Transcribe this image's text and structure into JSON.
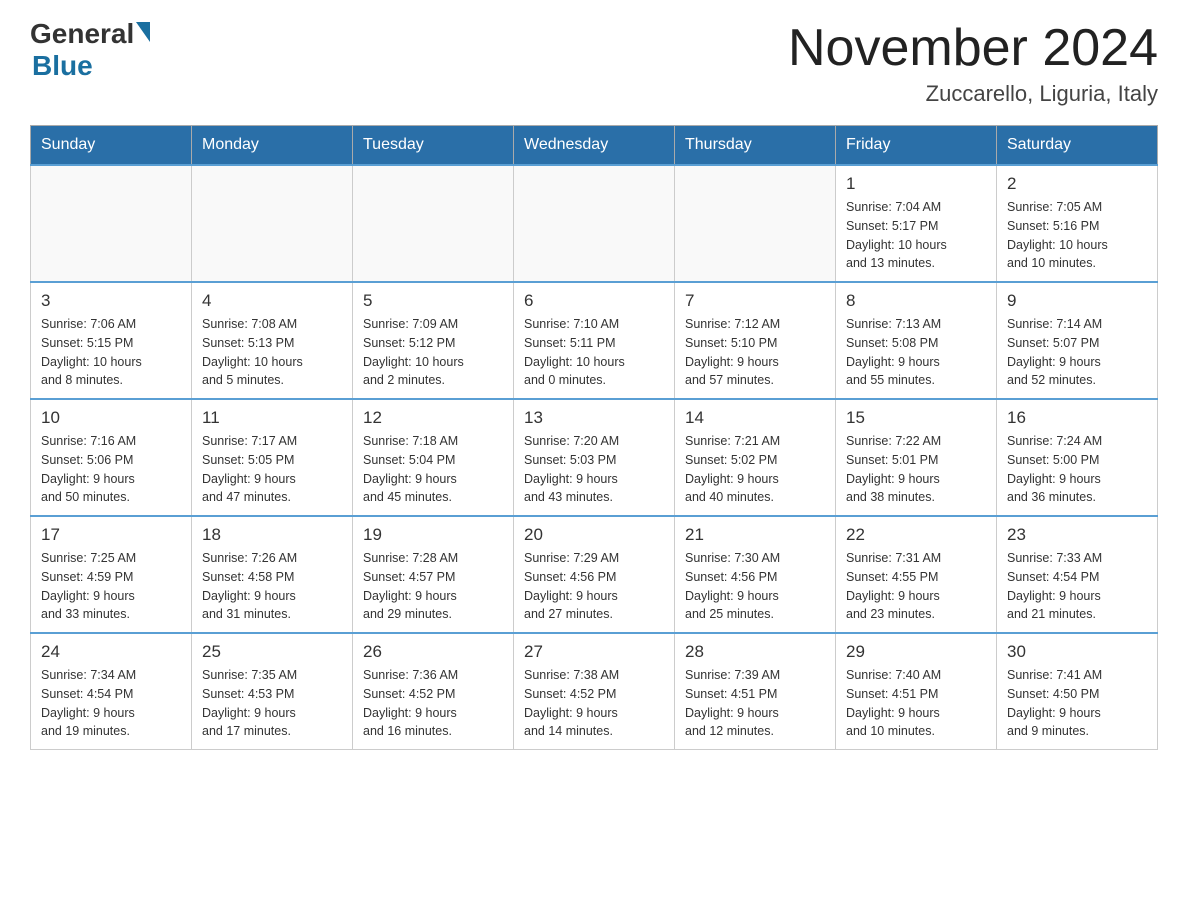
{
  "header": {
    "logo_general": "General",
    "logo_blue": "Blue",
    "title": "November 2024",
    "subtitle": "Zuccarello, Liguria, Italy"
  },
  "weekdays": [
    "Sunday",
    "Monday",
    "Tuesday",
    "Wednesday",
    "Thursday",
    "Friday",
    "Saturday"
  ],
  "weeks": [
    {
      "days": [
        {
          "num": "",
          "info": "",
          "empty": true
        },
        {
          "num": "",
          "info": "",
          "empty": true
        },
        {
          "num": "",
          "info": "",
          "empty": true
        },
        {
          "num": "",
          "info": "",
          "empty": true
        },
        {
          "num": "",
          "info": "",
          "empty": true
        },
        {
          "num": "1",
          "info": "Sunrise: 7:04 AM\nSunset: 5:17 PM\nDaylight: 10 hours\nand 13 minutes."
        },
        {
          "num": "2",
          "info": "Sunrise: 7:05 AM\nSunset: 5:16 PM\nDaylight: 10 hours\nand 10 minutes."
        }
      ]
    },
    {
      "days": [
        {
          "num": "3",
          "info": "Sunrise: 7:06 AM\nSunset: 5:15 PM\nDaylight: 10 hours\nand 8 minutes."
        },
        {
          "num": "4",
          "info": "Sunrise: 7:08 AM\nSunset: 5:13 PM\nDaylight: 10 hours\nand 5 minutes."
        },
        {
          "num": "5",
          "info": "Sunrise: 7:09 AM\nSunset: 5:12 PM\nDaylight: 10 hours\nand 2 minutes."
        },
        {
          "num": "6",
          "info": "Sunrise: 7:10 AM\nSunset: 5:11 PM\nDaylight: 10 hours\nand 0 minutes."
        },
        {
          "num": "7",
          "info": "Sunrise: 7:12 AM\nSunset: 5:10 PM\nDaylight: 9 hours\nand 57 minutes."
        },
        {
          "num": "8",
          "info": "Sunrise: 7:13 AM\nSunset: 5:08 PM\nDaylight: 9 hours\nand 55 minutes."
        },
        {
          "num": "9",
          "info": "Sunrise: 7:14 AM\nSunset: 5:07 PM\nDaylight: 9 hours\nand 52 minutes."
        }
      ]
    },
    {
      "days": [
        {
          "num": "10",
          "info": "Sunrise: 7:16 AM\nSunset: 5:06 PM\nDaylight: 9 hours\nand 50 minutes."
        },
        {
          "num": "11",
          "info": "Sunrise: 7:17 AM\nSunset: 5:05 PM\nDaylight: 9 hours\nand 47 minutes."
        },
        {
          "num": "12",
          "info": "Sunrise: 7:18 AM\nSunset: 5:04 PM\nDaylight: 9 hours\nand 45 minutes."
        },
        {
          "num": "13",
          "info": "Sunrise: 7:20 AM\nSunset: 5:03 PM\nDaylight: 9 hours\nand 43 minutes."
        },
        {
          "num": "14",
          "info": "Sunrise: 7:21 AM\nSunset: 5:02 PM\nDaylight: 9 hours\nand 40 minutes."
        },
        {
          "num": "15",
          "info": "Sunrise: 7:22 AM\nSunset: 5:01 PM\nDaylight: 9 hours\nand 38 minutes."
        },
        {
          "num": "16",
          "info": "Sunrise: 7:24 AM\nSunset: 5:00 PM\nDaylight: 9 hours\nand 36 minutes."
        }
      ]
    },
    {
      "days": [
        {
          "num": "17",
          "info": "Sunrise: 7:25 AM\nSunset: 4:59 PM\nDaylight: 9 hours\nand 33 minutes."
        },
        {
          "num": "18",
          "info": "Sunrise: 7:26 AM\nSunset: 4:58 PM\nDaylight: 9 hours\nand 31 minutes."
        },
        {
          "num": "19",
          "info": "Sunrise: 7:28 AM\nSunset: 4:57 PM\nDaylight: 9 hours\nand 29 minutes."
        },
        {
          "num": "20",
          "info": "Sunrise: 7:29 AM\nSunset: 4:56 PM\nDaylight: 9 hours\nand 27 minutes."
        },
        {
          "num": "21",
          "info": "Sunrise: 7:30 AM\nSunset: 4:56 PM\nDaylight: 9 hours\nand 25 minutes."
        },
        {
          "num": "22",
          "info": "Sunrise: 7:31 AM\nSunset: 4:55 PM\nDaylight: 9 hours\nand 23 minutes."
        },
        {
          "num": "23",
          "info": "Sunrise: 7:33 AM\nSunset: 4:54 PM\nDaylight: 9 hours\nand 21 minutes."
        }
      ]
    },
    {
      "days": [
        {
          "num": "24",
          "info": "Sunrise: 7:34 AM\nSunset: 4:54 PM\nDaylight: 9 hours\nand 19 minutes."
        },
        {
          "num": "25",
          "info": "Sunrise: 7:35 AM\nSunset: 4:53 PM\nDaylight: 9 hours\nand 17 minutes."
        },
        {
          "num": "26",
          "info": "Sunrise: 7:36 AM\nSunset: 4:52 PM\nDaylight: 9 hours\nand 16 minutes."
        },
        {
          "num": "27",
          "info": "Sunrise: 7:38 AM\nSunset: 4:52 PM\nDaylight: 9 hours\nand 14 minutes."
        },
        {
          "num": "28",
          "info": "Sunrise: 7:39 AM\nSunset: 4:51 PM\nDaylight: 9 hours\nand 12 minutes."
        },
        {
          "num": "29",
          "info": "Sunrise: 7:40 AM\nSunset: 4:51 PM\nDaylight: 9 hours\nand 10 minutes."
        },
        {
          "num": "30",
          "info": "Sunrise: 7:41 AM\nSunset: 4:50 PM\nDaylight: 9 hours\nand 9 minutes."
        }
      ]
    }
  ]
}
